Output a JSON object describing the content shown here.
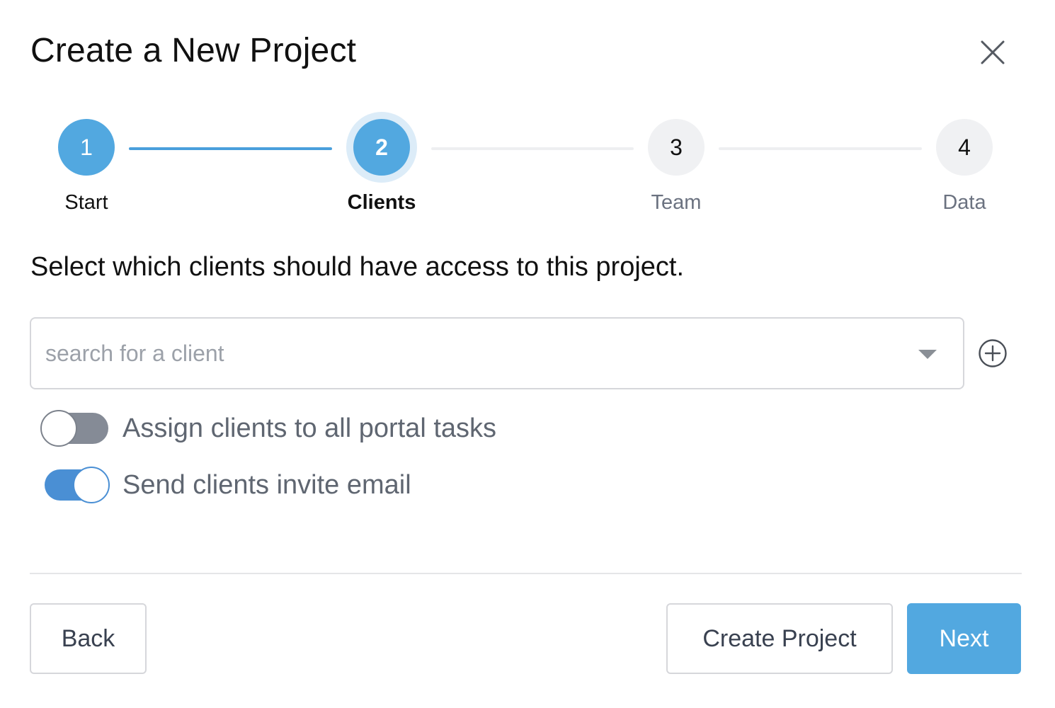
{
  "dialog": {
    "title": "Create a New Project",
    "close_icon": "close-icon"
  },
  "stepper": {
    "current_step": 2,
    "steps": [
      {
        "number": "1",
        "label": "Start",
        "state": "done"
      },
      {
        "number": "2",
        "label": "Clients",
        "state": "active"
      },
      {
        "number": "3",
        "label": "Team",
        "state": "pending"
      },
      {
        "number": "4",
        "label": "Data",
        "state": "pending"
      }
    ]
  },
  "instruction": "Select which clients should have access to this project.",
  "client_search": {
    "placeholder": "search for a client",
    "value": "",
    "dropdown_icon": "caret-down-icon",
    "add_icon": "plus-circle-icon"
  },
  "options": {
    "assign_all_tasks": {
      "label": "Assign clients to all portal tasks",
      "enabled": false
    },
    "send_invite": {
      "label": "Send clients invite email",
      "enabled": true
    }
  },
  "footer": {
    "back_label": "Back",
    "create_label": "Create Project",
    "next_label": "Next"
  },
  "colors": {
    "accent": "#52a8e0",
    "toggle_on": "#4a8fd4",
    "toggle_off": "#858b96"
  }
}
